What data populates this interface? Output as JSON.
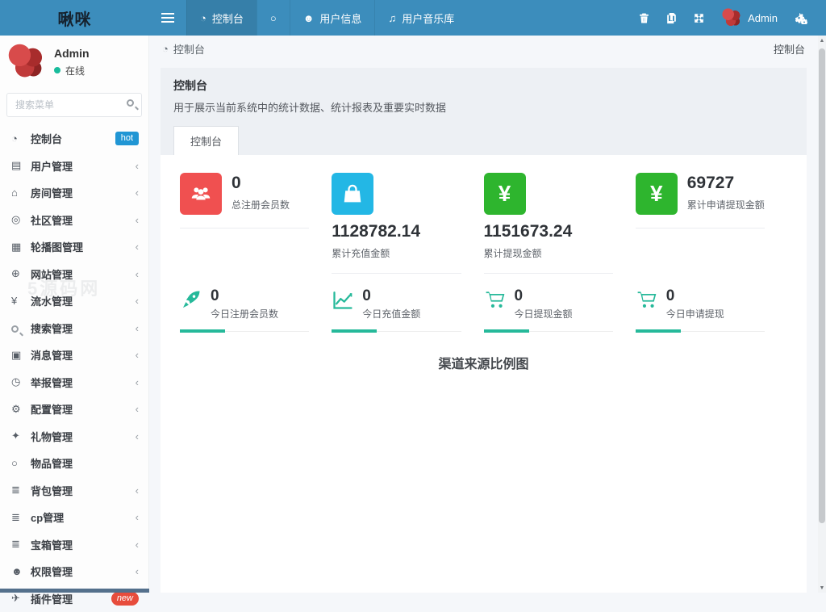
{
  "colors": {
    "navbar": "#3c8dbc",
    "navbar_active": "#367fa9",
    "stat_red": "#f05050",
    "stat_cyan": "#23b7e5",
    "stat_green": "#2eb52e",
    "mini_teal": "#26b99a",
    "hot_badge": "#2196d4",
    "new_badge": "#e74c3c",
    "online_dot": "#18bc9c"
  },
  "icons": {
    "dashboard": "◔",
    "circle": "○",
    "user": "☻",
    "music": "♫",
    "id-card": "▤",
    "bank": "⌂",
    "community": "◎",
    "image": "▦",
    "globe": "⊕",
    "money": "¥",
    "message": "▣",
    "report": "◷",
    "config": "⚙",
    "gift": "✦",
    "item": "○",
    "list": "≣",
    "users": "☻",
    "plugin": "✈",
    "chevron": "‹"
  },
  "navbar": {
    "brand": "啾咪",
    "tabs": [
      {
        "label": "控制台",
        "icon": "dashboard",
        "active": true
      },
      {
        "label": "",
        "icon": "circle",
        "active": false
      },
      {
        "label": "用户信息",
        "icon": "user",
        "active": false
      },
      {
        "label": "用户音乐库",
        "icon": "music",
        "active": false
      }
    ],
    "username": "Admin"
  },
  "sidebar": {
    "user": {
      "name": "Admin",
      "status": "在线"
    },
    "search_placeholder": "搜索菜单",
    "watermark": "5源码网",
    "items": [
      {
        "label": "控制台",
        "icon": "dashboard",
        "badge": "hot",
        "badge_style": "square",
        "arrow": false
      },
      {
        "label": "用户管理",
        "icon": "id-card",
        "arrow": true
      },
      {
        "label": "房间管理",
        "icon": "bank",
        "arrow": true
      },
      {
        "label": "社区管理",
        "icon": "community",
        "arrow": true
      },
      {
        "label": "轮播图管理",
        "icon": "image",
        "arrow": true
      },
      {
        "label": "网站管理",
        "icon": "globe",
        "arrow": true
      },
      {
        "label": "流水管理",
        "icon": "money",
        "arrow": true
      },
      {
        "label": "搜索管理",
        "icon": "search",
        "arrow": true
      },
      {
        "label": "消息管理",
        "icon": "message",
        "arrow": true
      },
      {
        "label": "举报管理",
        "icon": "report",
        "arrow": true
      },
      {
        "label": "配置管理",
        "icon": "config",
        "arrow": true
      },
      {
        "label": "礼物管理",
        "icon": "gift",
        "arrow": true
      },
      {
        "label": "物品管理",
        "icon": "item",
        "arrow": false
      },
      {
        "label": "背包管理",
        "icon": "list",
        "arrow": true
      },
      {
        "label": "cp管理",
        "icon": "list",
        "arrow": true
      },
      {
        "label": "宝箱管理",
        "icon": "list",
        "arrow": true
      },
      {
        "label": "权限管理",
        "icon": "users",
        "arrow": true
      },
      {
        "label": "插件管理",
        "icon": "plugin",
        "badge": "new",
        "badge_style": "pill",
        "arrow": false
      }
    ]
  },
  "breadcrumb": {
    "left": "控制台",
    "right": "控制台"
  },
  "page_header": {
    "title": "控制台",
    "subtitle": "用于展示当前系统中的统计数据、统计报表及重要实时数据"
  },
  "content_tab": "控制台",
  "stats_primary": [
    {
      "value": "0",
      "label": "总注册会员数",
      "icon": "users-group",
      "color": "#f05050",
      "layout": "side"
    },
    {
      "value": "1128782.14",
      "label": "累计充值金额",
      "icon": "shopping-bag",
      "color": "#23b7e5",
      "layout": "below"
    },
    {
      "value": "1151673.24",
      "label": "累计提现金额",
      "icon": "yen",
      "color": "#2eb52e",
      "layout": "below"
    },
    {
      "value": "69727",
      "label": "累计申请提现金额",
      "icon": "yen",
      "color": "#2eb52e",
      "layout": "side"
    }
  ],
  "stats_secondary": [
    {
      "value": "0",
      "label": "今日注册会员数",
      "icon": "rocket"
    },
    {
      "value": "0",
      "label": "今日充值金额",
      "icon": "chart-line"
    },
    {
      "value": "0",
      "label": "今日提现金额",
      "icon": "cart"
    },
    {
      "value": "0",
      "label": "今日申请提现",
      "icon": "cart"
    }
  ],
  "chart_section": {
    "title": "渠道来源比例图"
  }
}
